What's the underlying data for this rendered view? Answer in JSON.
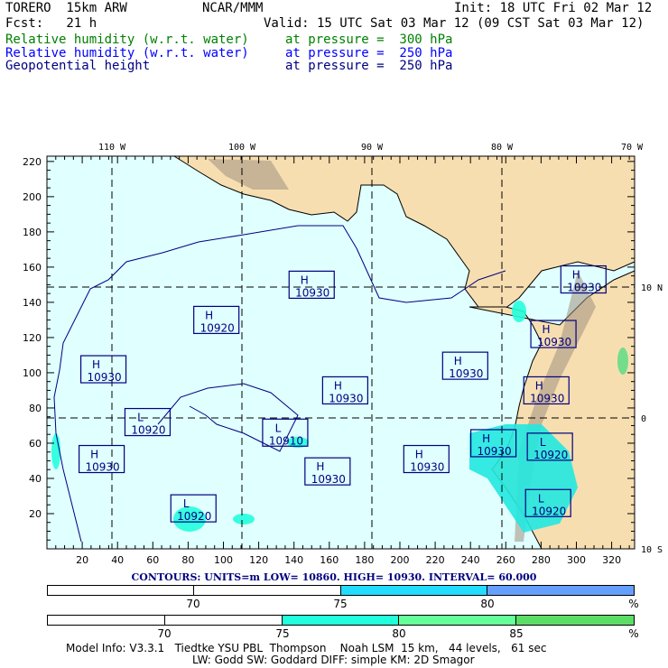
{
  "header": {
    "model": "TORERO  15km ARW",
    "org": "NCAR/MMM",
    "init": "Init: 18 UTC Fri 02 Mar 12",
    "fcst": "Fcst:   21 h",
    "valid": "Valid: 15 UTC Sat 03 Mar 12 (09 CST Sat 03 Mar 12)",
    "fields": [
      {
        "name": "Relative humidity (w.r.t. water)",
        "level": "at pressure =  300 hPa",
        "color": "#008000"
      },
      {
        "name": "Relative humidity (w.r.t. water)",
        "level": "at pressure =  250 hPa",
        "color": "#0000ff"
      },
      {
        "name": "Geopotential height",
        "level": "at pressure =  250 hPa",
        "color": "#000080"
      }
    ]
  },
  "chart_data": {
    "type": "heatmap",
    "title": "Geopotential height 250 hPa with relative humidity 250/300 hPa",
    "x_ticks": [
      "20",
      "40",
      "60",
      "80",
      "100",
      "120",
      "140",
      "160",
      "180",
      "200",
      "220",
      "240",
      "260",
      "280",
      "300",
      "320"
    ],
    "y_ticks": [
      "20",
      "40",
      "60",
      "80",
      "100",
      "120",
      "140",
      "160",
      "180",
      "200",
      "220"
    ],
    "lon_labels": [
      "110 W",
      "100 W",
      "90 W",
      "80 W",
      "70 W"
    ],
    "lat_labels": [
      "10 N",
      "0",
      "10 S"
    ],
    "centers": [
      {
        "type": "H",
        "value": "10930",
        "x": 150,
        "y": 150
      },
      {
        "type": "H",
        "value": "10920",
        "x": 96,
        "y": 130
      },
      {
        "type": "H",
        "value": "10930",
        "x": 32,
        "y": 102
      },
      {
        "type": "L",
        "value": "10920",
        "x": 57,
        "y": 72
      },
      {
        "type": "H",
        "value": "10930",
        "x": 31,
        "y": 51
      },
      {
        "type": "L",
        "value": "10920",
        "x": 83,
        "y": 23
      },
      {
        "type": "H",
        "value": "10930",
        "x": 169,
        "y": 90
      },
      {
        "type": "L",
        "value": "10910",
        "x": 135,
        "y": 66
      },
      {
        "type": "H",
        "value": "10930",
        "x": 159,
        "y": 44
      },
      {
        "type": "H",
        "value": "10930",
        "x": 215,
        "y": 51
      },
      {
        "type": "H",
        "value": "10930",
        "x": 237,
        "y": 104
      },
      {
        "type": "H",
        "value": "10930",
        "x": 304,
        "y": 153
      },
      {
        "type": "H",
        "value": "10930",
        "x": 287,
        "y": 122
      },
      {
        "type": "H",
        "value": "10930",
        "x": 283,
        "y": 90
      },
      {
        "type": "H",
        "value": "10930",
        "x": 253,
        "y": 60
      },
      {
        "type": "L",
        "value": "10920",
        "x": 285,
        "y": 58
      },
      {
        "type": "L",
        "value": "10920",
        "x": 284,
        "y": 26
      }
    ],
    "contours": {
      "text": "CONTOURS:  UNITS=m  LOW=  10860.     HIGH=  10930.     INTERVAL=   60.000",
      "units": "m",
      "low": 10860,
      "high": 10930,
      "interval": 60
    }
  },
  "colorbars": [
    {
      "labels": [
        "70",
        "75",
        "80",
        "%"
      ],
      "colors": [
        "#ffffff",
        "#ffffff",
        "#22ddff",
        "#66a0ff"
      ]
    },
    {
      "labels": [
        "70",
        "75",
        "80",
        "85",
        "%"
      ],
      "colors": [
        "#ffffff",
        "#ffffff",
        "#22ffdd",
        "#66ff99",
        "#5cdd66"
      ]
    }
  ],
  "footer": {
    "line1": "Model Info: V3.3.1   Tiedtke YSU PBL  Thompson    Noah LSM  15 km,   44 levels,   61 sec",
    "line2": "LW: Godd SW: Goddard DIFF: simple KM: 2D Smagor"
  }
}
